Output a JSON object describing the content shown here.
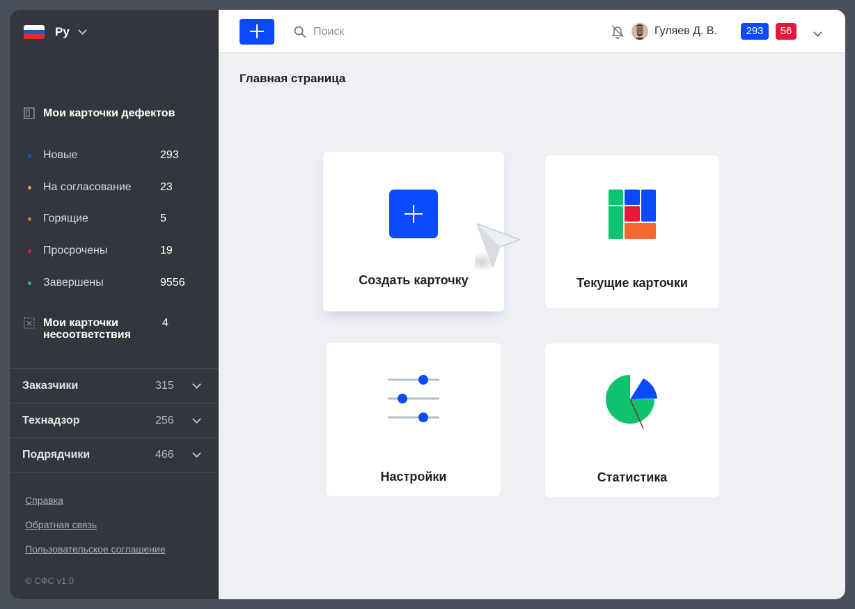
{
  "language": {
    "label": "Ру"
  },
  "sidebar": {
    "my_defects_title": "Мои карточки дефектов",
    "statuses": [
      {
        "label": "Новые",
        "count": "293",
        "color": "#0a4bff"
      },
      {
        "label": "На согласование",
        "count": "23",
        "color": "#f6a623"
      },
      {
        "label": "Горящие",
        "count": "5",
        "color": "#f26a2e"
      },
      {
        "label": "Просрочены",
        "count": "19",
        "color": "#e5173a"
      },
      {
        "label": "Завершены",
        "count": "9556",
        "color": "#0fc36e"
      }
    ],
    "ncr": {
      "line1": "Мои карточки",
      "line2": "несоответствия",
      "count": "4"
    },
    "groups": [
      {
        "label": "Заказчики",
        "count": "315"
      },
      {
        "label": "Технадзор",
        "count": "256"
      },
      {
        "label": "Подрядчики",
        "count": "466"
      }
    ],
    "links": [
      "Справка",
      "Обратная связь",
      "Пользовательское соглашение"
    ],
    "copyright": "© СФС v1.0"
  },
  "topbar": {
    "search_placeholder": "Поиск",
    "user_name": "Гуляев Д. В.",
    "badge_blue": "293",
    "badge_red": "56",
    "accent": "#0a4bff",
    "alert": "#e5173a"
  },
  "main": {
    "page_title": "Главная страница",
    "tiles": {
      "create": "Создать карточку",
      "current": "Текущие карточки",
      "settings": "Настройки",
      "stats": "Статистика"
    }
  }
}
